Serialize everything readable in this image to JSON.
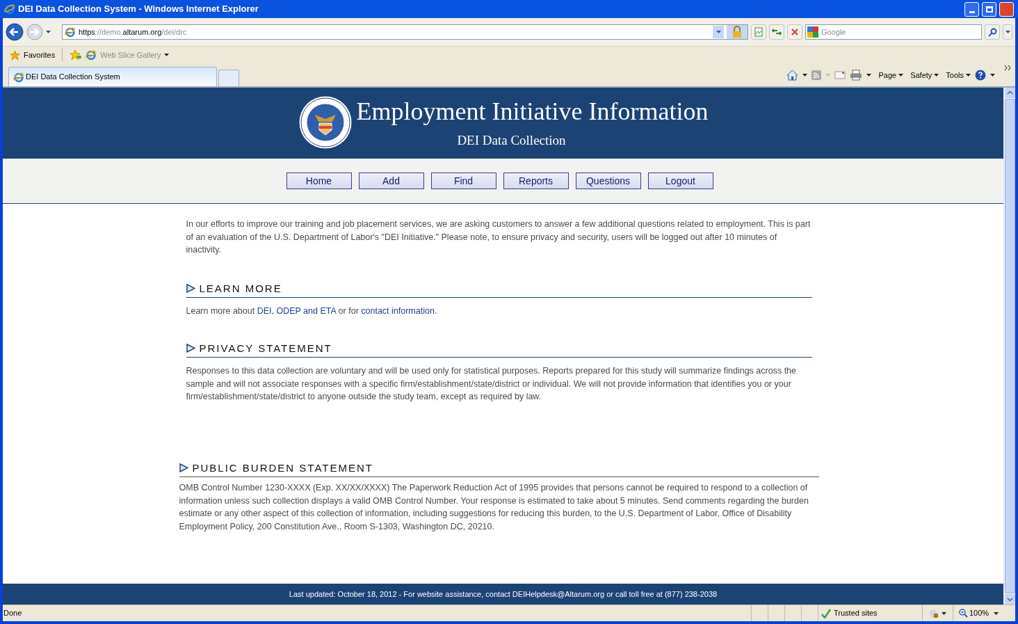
{
  "window": {
    "title": "DEI Data Collection System - Windows Internet Explorer"
  },
  "address_bar": {
    "url_parts": [
      {
        "text": "https",
        "dim": false
      },
      {
        "text": "://demo.",
        "dim": true
      },
      {
        "text": "altarum.org",
        "dim": false
      },
      {
        "text": "/dei/drc",
        "dim": true
      }
    ]
  },
  "search": {
    "placeholder": "Google"
  },
  "favorites_bar": {
    "label": "Favorites",
    "items": [
      {
        "label": "Web Slice Gallery",
        "disabled": true
      }
    ]
  },
  "tabs": [
    {
      "label": "DEI Data Collection System",
      "selected": true
    }
  ],
  "command_bar": {
    "feeds_disabled": true,
    "menus": [
      "Page",
      "Safety",
      "Tools"
    ]
  },
  "header": {
    "title": "Employment Initiative Information",
    "subtitle": "DEI Data Collection"
  },
  "nav": [
    "Home",
    "Add",
    "Find",
    "Reports",
    "Questions",
    "Logout"
  ],
  "intro": "In our efforts to improve our training and job placement services, we are asking customers to answer a few additional questions related to employment. This is part of an evaluation of the U.S. Department of Labor's \"DEI Initiative.\" Please note, to ensure privacy and security, users will be logged out after 10 minutes of inactivity.",
  "sections": [
    {
      "heading": "LEARN MORE",
      "parts": [
        {
          "text": "Learn more about ",
          "link": false
        },
        {
          "text": "DEI, ODEP and ETA",
          "link": true
        },
        {
          "text": " or for ",
          "link": false
        },
        {
          "text": "contact information",
          "link": true
        },
        {
          "text": ".",
          "link": false
        }
      ]
    },
    {
      "heading": "PRIVACY STATEMENT",
      "parts": [
        {
          "text": "Responses to this data collection are voluntary and will be used only for statistical purposes. Reports prepared for this study will summarize findings across the sample and will not associate responses with a specific firm/establishment/state/district or individual. We will not provide information that identifies you or your firm/establishment/state/district to anyone outside the study team, except as required by law.",
          "link": false
        }
      ]
    }
  ],
  "burden": {
    "heading": "PUBLIC BURDEN STATEMENT",
    "text": "OMB Control Number 1230-XXXX (Exp. XX/XX/XXXX) The Paperwork Reduction Act of 1995 provides that persons cannot be required to respond to a collection of information unless such collection displays a valid OMB Control Number. Your response is estimated to take about 5 minutes. Send comments regarding the burden estimate or any other aspect of this collection of information, including suggestions for reducing this burden, to the U.S. Department of Labor, Office of Disability Employment Policy, 200 Constitution Ave., Room S-1303, Washington DC, 20210."
  },
  "footer": "Last updated: October 18, 2012 - For website assistance, contact DEIHelpdesk@Altarum.org or call toll free at (877) 238-2038",
  "status_bar": {
    "text": "Done",
    "zone": "Trusted sites",
    "zoom": "100%"
  }
}
